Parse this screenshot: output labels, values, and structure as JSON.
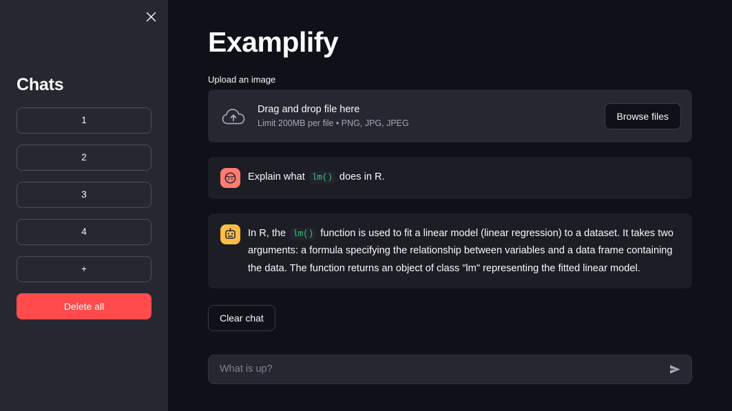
{
  "theme": {
    "sidebar_bg": "#262730",
    "main_bg": "#0e1117",
    "message_bg": "#1c1d25",
    "text": "#fafafa",
    "muted_text": "#a3a8b8",
    "accent_red": "#ff4b4b",
    "user_avatar_bg": "#ff7b72",
    "assistant_avatar_bg": "#ffbd45",
    "code_green": "#2ecc71"
  },
  "sidebar": {
    "close_icon": "close-icon",
    "title": "Chats",
    "chat_buttons": [
      {
        "label": "1"
      },
      {
        "label": "2"
      },
      {
        "label": "3"
      },
      {
        "label": "4"
      },
      {
        "label": "+"
      }
    ],
    "delete_all_label": "Delete all"
  },
  "main": {
    "title": "Examplify",
    "uploader": {
      "label": "Upload an image",
      "icon": "cloud-upload-icon",
      "drop_text": "Drag and drop file here",
      "limit_text": "Limit 200MB per file • PNG, JPG, JPEG",
      "browse_label": "Browse files"
    },
    "messages": [
      {
        "role": "user",
        "avatar_icon": "user-face-icon",
        "text_before": "Explain what",
        "code": "lm()",
        "text_after": "does in R."
      },
      {
        "role": "assistant",
        "avatar_icon": "robot-icon",
        "text_before": "In R, the",
        "code": "lm()",
        "text_after": "function is used to fit a linear model (linear regression) to a dataset. It takes two arguments: a formula specifying the relationship between variables and a data frame containing the data. The function returns an object of class \"lm\" representing the fitted linear model."
      }
    ],
    "clear_chat_label": "Clear chat",
    "chat_input": {
      "value": "",
      "placeholder": "What is up?",
      "send_icon": "send-icon"
    }
  }
}
